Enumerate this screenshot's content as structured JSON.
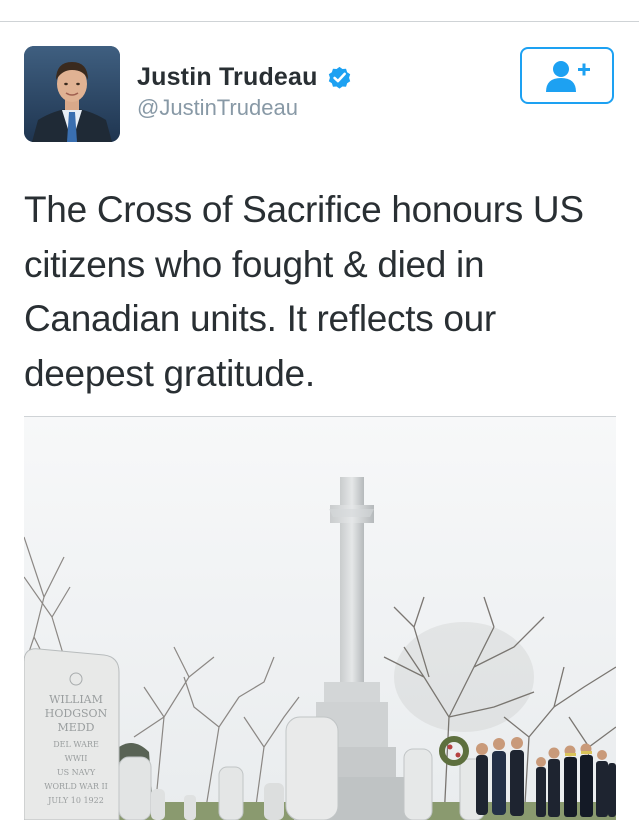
{
  "user": {
    "display_name": "Justin Trudeau",
    "handle": "@JustinTrudeau",
    "verified_icon": "verified-badge-icon",
    "avatar_icon": "profile-photo"
  },
  "follow_button": {
    "icon": "add-user-icon",
    "color": "#1da1f2"
  },
  "tweet": {
    "text_lines": [
      "The Cross of Sacrifice honours US",
      "citizens who fought & died in",
      "Canadian units. It reflects our",
      "deepest gratitude."
    ]
  },
  "media": {
    "headstone_text": [
      "WILLIAM",
      "HODGSON",
      "MEDD",
      "DEL WARE",
      "WWII",
      "US NAVY",
      "WORLD WAR II",
      "JULY 10 1922"
    ]
  },
  "colors": {
    "accent": "#1da1f2",
    "text": "#292f33",
    "secondary": "#8899a6"
  }
}
